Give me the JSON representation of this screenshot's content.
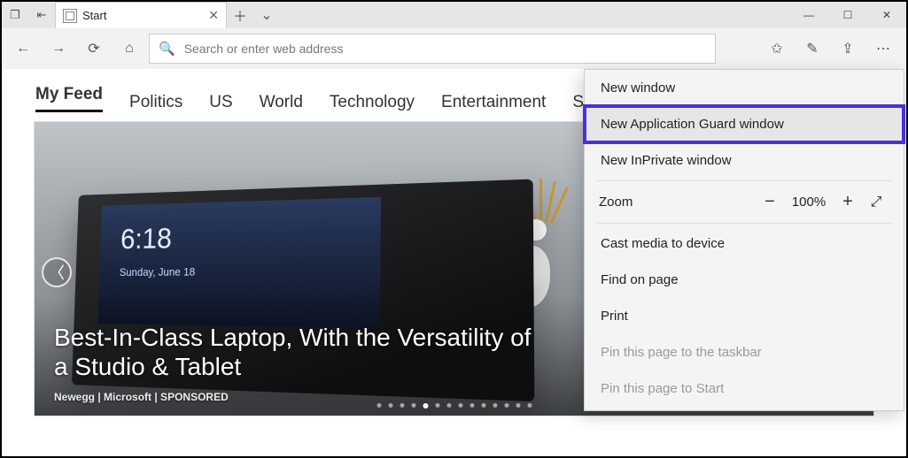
{
  "tab": {
    "label": "Start"
  },
  "address": {
    "placeholder": "Search or enter web address"
  },
  "nav_tabs": [
    "My Feed",
    "Politics",
    "US",
    "World",
    "Technology",
    "Entertainment",
    "Sports"
  ],
  "nav_active_index": 0,
  "hero": {
    "clock": "6:18",
    "date": "Sunday, June 18",
    "caption": "Best-In-Class Laptop, With the Versatility of a Studio & Tablet",
    "sponsor": "Newegg | Microsoft | SPONSORED",
    "dot_count": 14,
    "dot_active": 4
  },
  "menu": {
    "new_window": "New window",
    "new_appguard": "New Application Guard window",
    "new_inprivate": "New InPrivate window",
    "zoom_label": "Zoom",
    "zoom_value": "100%",
    "cast": "Cast media to device",
    "find": "Find on page",
    "print": "Print",
    "pin_taskbar": "Pin this page to the taskbar",
    "pin_start": "Pin this page to Start"
  }
}
